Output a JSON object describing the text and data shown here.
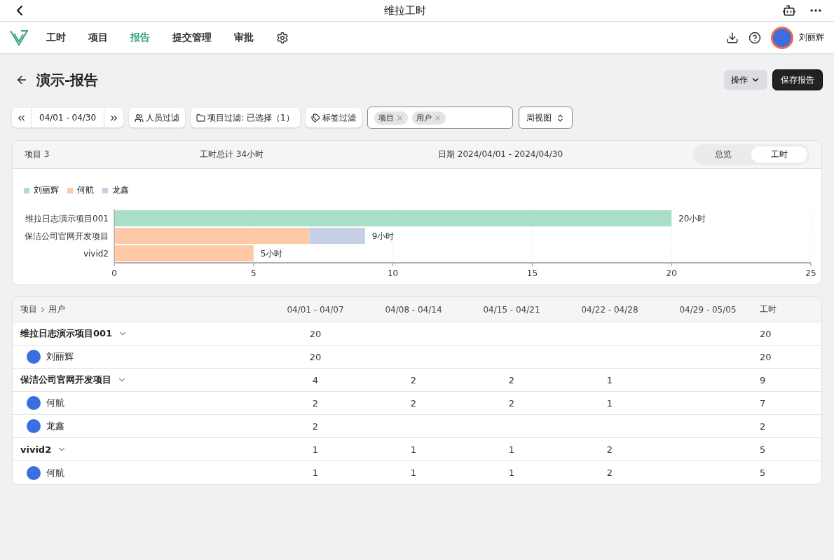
{
  "app_bar": {
    "title": "维拉工时"
  },
  "nav": {
    "items": [
      {
        "label": "工时",
        "selected": false
      },
      {
        "label": "项目",
        "selected": false
      },
      {
        "label": "报告",
        "selected": true
      },
      {
        "label": "提交管理",
        "selected": false
      },
      {
        "label": "审批",
        "selected": false
      }
    ],
    "user": "刘丽辉"
  },
  "page": {
    "title": "演示-报告",
    "actions": [
      "操作",
      "保存报告"
    ]
  },
  "filters": {
    "date_range": "04/01 - 04/30",
    "people": "人员过滤",
    "project": "项目过滤: 已选择（1）",
    "tags": "标签过滤",
    "group_by": [
      "项目",
      "用户"
    ],
    "view": "周视图"
  },
  "summary": {
    "projects": "项目 3",
    "total": "工时总计 34小时",
    "date": "日期 2024/04/01 - 2024/04/30",
    "tabs": [
      {
        "label": "总览",
        "selected": false
      },
      {
        "label": "工时",
        "selected": true
      }
    ],
    "chart_data": {
      "type": "bar",
      "orientation": "horizontal",
      "stacked": true,
      "grid": true,
      "categories": [
        "维拉日志演示项目001",
        "保洁公司官网开发项目",
        "vivid2"
      ],
      "series": [
        {
          "name": "刘丽辉",
          "color": "#a9dfc6",
          "values": [
            20,
            0,
            0
          ]
        },
        {
          "name": "何航",
          "color": "#ffc9a8",
          "values": [
            0,
            7,
            5
          ]
        },
        {
          "name": "龙鑫",
          "color": "#c6cfe3",
          "values": [
            0,
            2,
            0
          ]
        }
      ],
      "xlim": [
        0,
        25
      ],
      "xticks": [
        0,
        5,
        10,
        15,
        20,
        25
      ],
      "value_labels": [
        "20小时",
        "9小时",
        "5小时"
      ]
    }
  },
  "table": {
    "columns": [
      {
        "levels": [
          "项目",
          "用户"
        ]
      },
      "04/01 - 04/07",
      "04/08 - 04/14",
      "04/15 - 04/21",
      "04/22 - 04/28",
      "04/29 - 05/05",
      "工时"
    ],
    "rows": [
      {
        "expanded": true,
        "cells": [
          "维拉日志演示项目001",
          "20",
          "",
          "",
          "",
          "",
          "20"
        ],
        "children": [
          {
            "cells": [
              "刘丽辉",
              "20",
              "",
              "",
              "",
              "",
              "20"
            ]
          }
        ]
      },
      {
        "expanded": true,
        "cells": [
          "保洁公司官网开发项目",
          "4",
          "2",
          "2",
          "1",
          "",
          "9"
        ],
        "children": [
          {
            "cells": [
              "何航",
              "2",
              "2",
              "2",
              "1",
              "",
              "7"
            ]
          },
          {
            "cells": [
              "龙鑫",
              "2",
              "",
              "",
              "",
              "",
              "2"
            ]
          }
        ]
      },
      {
        "expanded": true,
        "cells": [
          "vivid2",
          "1",
          "1",
          "1",
          "2",
          "",
          "5"
        ],
        "children": [
          {
            "cells": [
              "何航",
              "1",
              "1",
              "1",
              "2",
              "",
              "5"
            ]
          }
        ]
      }
    ]
  }
}
